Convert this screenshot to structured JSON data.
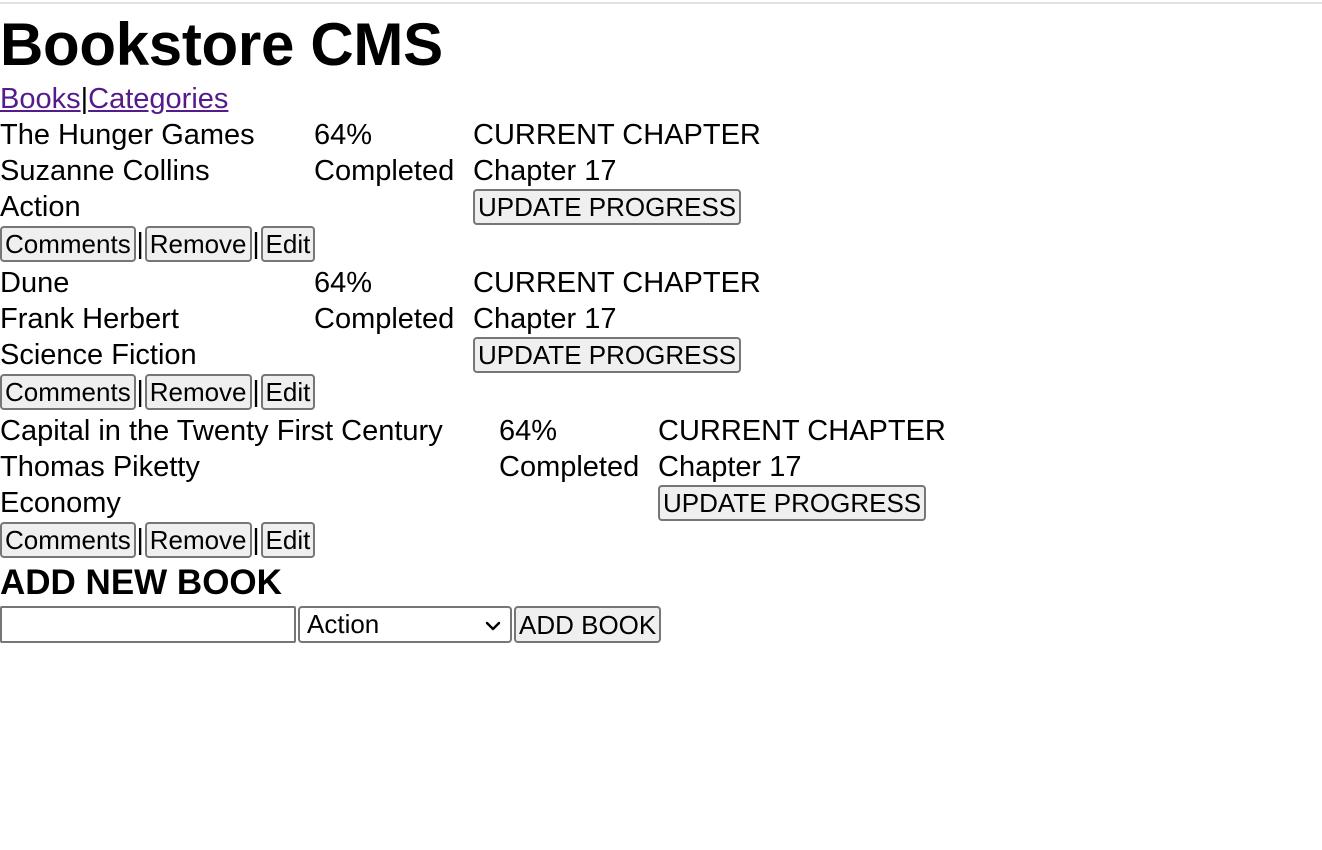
{
  "app": {
    "title": "Bookstore CMS"
  },
  "nav": {
    "items": [
      {
        "label": "Books"
      },
      {
        "label": "Categories"
      }
    ],
    "separator": "|"
  },
  "books": [
    {
      "title": "The Hunger Games",
      "author": "Suzanne Collins",
      "category": "Action",
      "percent": "64%",
      "status": "Completed",
      "chapter_heading": "CURRENT CHAPTER",
      "chapter": "Chapter 17",
      "update_label": "UPDATE PROGRESS",
      "actions": {
        "comments": "Comments",
        "remove": "Remove",
        "edit": "Edit",
        "separator": "|"
      }
    },
    {
      "title": "Dune",
      "author": "Frank Herbert",
      "category": "Science Fiction",
      "percent": "64%",
      "status": "Completed",
      "chapter_heading": "CURRENT CHAPTER",
      "chapter": "Chapter 17",
      "update_label": "UPDATE PROGRESS",
      "actions": {
        "comments": "Comments",
        "remove": "Remove",
        "edit": "Edit",
        "separator": "|"
      }
    },
    {
      "title": "Capital in the Twenty First Century",
      "author": "Thomas Piketty",
      "category": "Economy",
      "percent": "64%",
      "status": "Completed",
      "chapter_heading": "CURRENT CHAPTER",
      "chapter": "Chapter 17",
      "update_label": "UPDATE PROGRESS",
      "actions": {
        "comments": "Comments",
        "remove": "Remove",
        "edit": "Edit",
        "separator": "|"
      }
    }
  ],
  "add_book": {
    "heading": "ADD NEW BOOK",
    "title_input_value": "",
    "category_selected": "Action",
    "submit_label": "ADD BOOK"
  },
  "colors": {
    "link": "#551a8b",
    "button_bg": "#efefef",
    "button_border": "#767676"
  },
  "icons": {
    "select_arrow": "chevron-down-icon"
  }
}
